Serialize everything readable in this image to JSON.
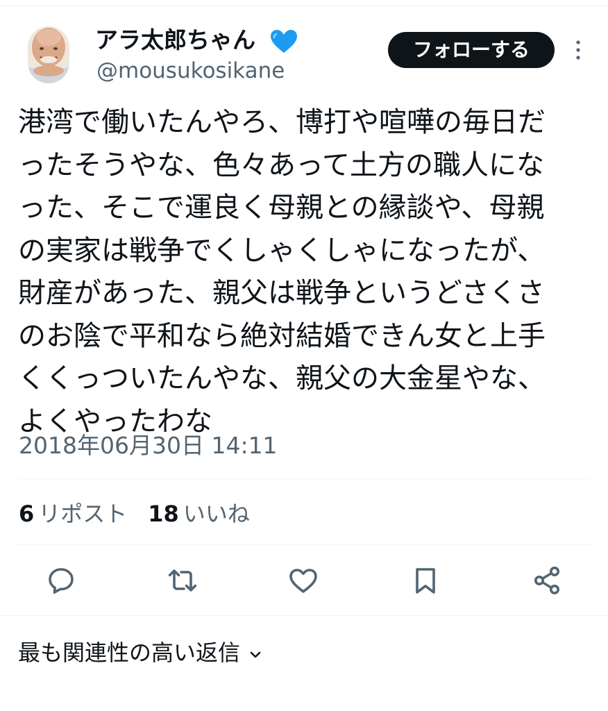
{
  "author": {
    "display_name": "アラ太郎ちゃん",
    "verified_icon": "blue-heart-icon",
    "handle": "@mousukosikane",
    "avatar_icon": "avatar-photo"
  },
  "header": {
    "follow_label": "フォローする",
    "more_icon": "more-vertical-icon"
  },
  "tweet": {
    "lines": [
      "港湾で働いたんやろ、博打や喧嘩の毎日だ",
      "ったそうやな、色々あって土方の職人にな",
      "った、そこで運良く母親との縁談や、母親",
      "の実家は戦争でくしゃくしゃになったが、",
      "財産があった、親父は戦争というどさくさ",
      "のお陰で平和なら絶対結婚できん女と上手",
      "くくっついたんやな、親父の大金星やな、",
      "よくやったわな"
    ],
    "timestamp": "2018年06月30日 14:11"
  },
  "stats": {
    "reposts_count": "6",
    "reposts_label": "リポスト",
    "likes_count": "18",
    "likes_label": "いいね"
  },
  "actions": [
    "reply-icon",
    "repost-icon",
    "like-icon",
    "bookmark-icon",
    "share-icon"
  ],
  "replies": {
    "sort_label": "最も関連性の高い返信",
    "sort_icon": "chevron-down-icon"
  },
  "colors": {
    "text_primary": "#0f1419",
    "text_secondary": "#536471",
    "divider": "#eff3f4",
    "follow_button_bg": "#0f1419",
    "verified_heart": "#1d9bf0"
  }
}
